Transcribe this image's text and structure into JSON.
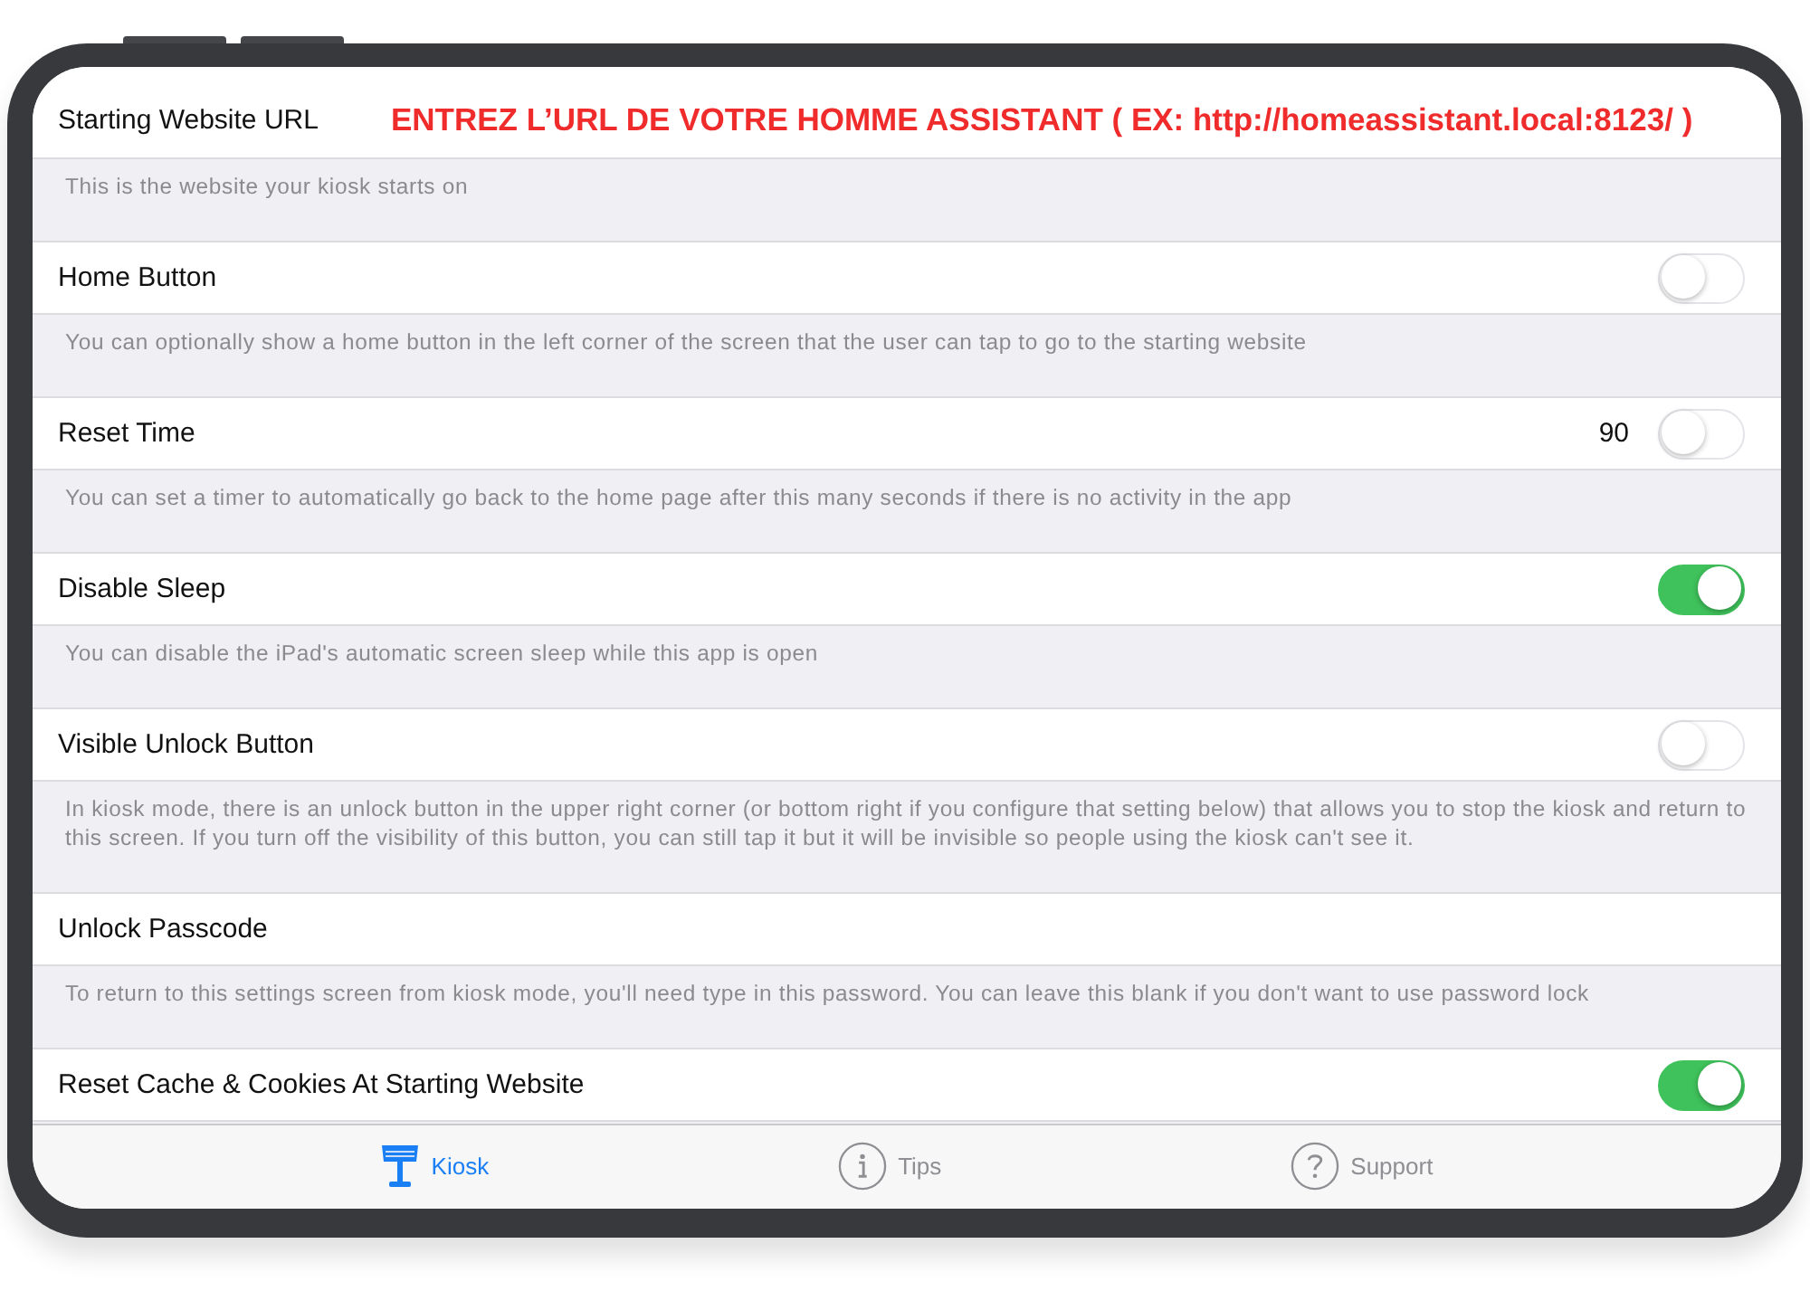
{
  "settings": [
    {
      "kind": "text",
      "label": "Starting Website URL",
      "annotation": "ENTREZ L’URL DE VOTRE HOMME ASSISTANT ( EX: http://homeassistant.local:8123/ )",
      "description": "This is the website your kiosk starts on"
    },
    {
      "kind": "toggle",
      "label": "Home Button",
      "on": false,
      "description": "You can optionally show a home button in the left corner of the screen that the user can tap to go to the starting website"
    },
    {
      "kind": "toggle",
      "label": "Reset Time",
      "value": "90",
      "on": false,
      "description": "You can set a timer to automatically go back to the home page after this many seconds if there is no activity in the app"
    },
    {
      "kind": "toggle",
      "label": "Disable Sleep",
      "on": true,
      "description": "You can disable the iPad's automatic screen sleep while this app is open"
    },
    {
      "kind": "toggle",
      "label": "Visible Unlock Button",
      "on": false,
      "description": "In kiosk mode, there is an unlock button in the upper right corner (or bottom right if you configure that setting below) that allows you to stop the kiosk and return to this screen.  If you turn off the visibility of this button, you can still tap it but it will be invisible so people using the kiosk can't see it."
    },
    {
      "kind": "text",
      "label": "Unlock Passcode",
      "description": "To return to this settings screen from kiosk mode, you'll need type in this password. You can leave this blank if you don't want to use password lock"
    },
    {
      "kind": "toggle",
      "label": "Reset Cache & Cookies At Starting Website",
      "on": true
    }
  ],
  "tab_bar": {
    "tabs": [
      {
        "label": "Kiosk",
        "selected": true
      },
      {
        "label": "Tips",
        "selected": false
      },
      {
        "label": "Support",
        "selected": false
      }
    ]
  }
}
